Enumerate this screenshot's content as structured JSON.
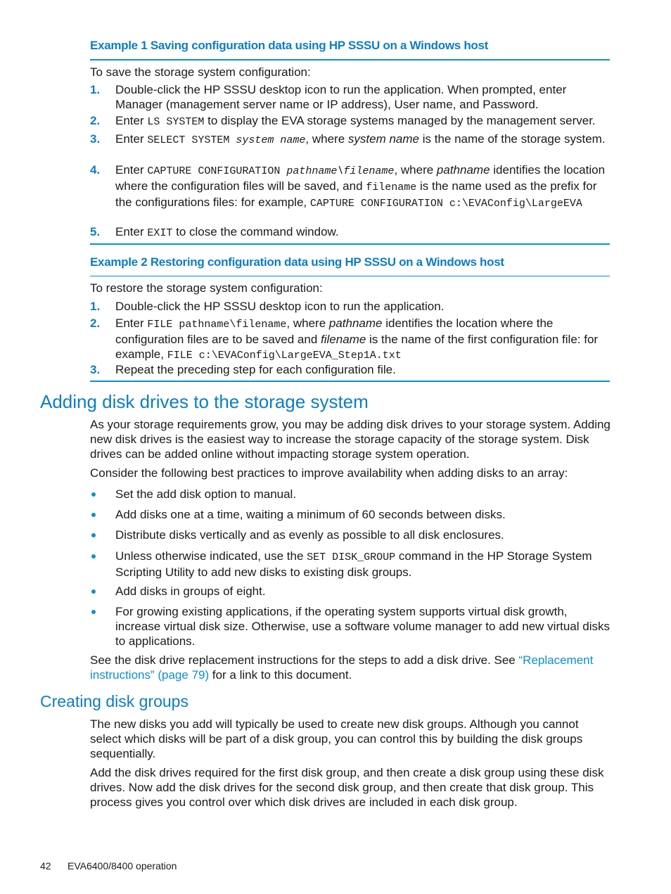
{
  "example1": {
    "title": "Example 1 Saving configuration data using HP SSSU on a Windows host",
    "intro": "To save the storage system configuration:",
    "steps": [
      {
        "num": "1.",
        "text": "Double-click the HP SSSU desktop icon to run the application. When prompted, enter Manager (management server name or IP address), User name, and Password."
      },
      {
        "num": "2.",
        "pre": "Enter ",
        "code": "LS SYSTEM",
        "post": " to display the EVA storage systems managed by the management server."
      },
      {
        "num": "3.",
        "pre": "Enter ",
        "code": "SELECT SYSTEM ",
        "code_ital": "system name",
        "mid": ", where ",
        "ital": "system name",
        "post": " is the name of the storage system."
      },
      {
        "num": "4.",
        "pre": "Enter ",
        "code": "CAPTURE CONFIGURATION ",
        "code_ital": "pathname\\filename",
        "mid": ", where ",
        "ital": "pathname",
        "post": " identifies the location where the configuration files will be saved, and ",
        "code2": "filename",
        "post2": " is the name used as the prefix for the configurations files: for example, ",
        "code3": "CAPTURE CONFIGURATION c:\\EVAConfig\\LargeEVA"
      },
      {
        "num": "5.",
        "pre": "Enter ",
        "code": "EXIT",
        "post": " to close the command window."
      }
    ]
  },
  "example2": {
    "title": "Example 2 Restoring configuration data using HP SSSU on a Windows host",
    "intro": "To restore the storage system configuration:",
    "steps": [
      {
        "num": "1.",
        "text": "Double-click the HP SSSU desktop icon to run the application."
      },
      {
        "num": "2.",
        "pre": "Enter ",
        "code": "FILE pathname\\filename",
        "mid": ", where ",
        "ital": "pathname",
        "post": " identifies the location where the configuration files are to be saved and ",
        "ital2": "filename",
        "post2": " is the name of the first configuration file: for example, ",
        "code2": "FILE c:\\EVAConfig\\LargeEVA_Step1A.txt"
      },
      {
        "num": "3.",
        "text": "Repeat the preceding step for each configuration file."
      }
    ]
  },
  "section_adding": {
    "heading": "Adding disk drives to the storage system",
    "para1": "As your storage requirements grow, you may be adding disk drives to your storage system. Adding new disk drives is the easiest way to increase the storage capacity of the storage system. Disk drives can be added online without impacting storage system operation.",
    "para2": "Consider the following best practices to improve availability when adding disks to an array:",
    "bullets": [
      {
        "text": "Set the add disk option to manual."
      },
      {
        "text": "Add disks one at a time, waiting a minimum of 60 seconds between disks."
      },
      {
        "text": "Distribute disks vertically and as evenly as possible to all disk enclosures."
      },
      {
        "pre": "Unless otherwise indicated, use the ",
        "code": "SET DISK_GROUP",
        "post": " command in the HP Storage System Scripting Utility to add new disks to existing disk groups."
      },
      {
        "text": "Add disks in groups of eight."
      },
      {
        "text": "For growing existing applications, if the operating system supports virtual disk growth, increase virtual disk size. Otherwise, use a software volume manager to add new virtual disks to applications."
      }
    ],
    "para3_pre": "See the disk drive replacement instructions for the steps to add a disk drive. See ",
    "para3_link": "“Replacement instructions” (page 79)",
    "para3_post": " for a link to this document."
  },
  "section_creating": {
    "heading": "Creating disk groups",
    "para1": "The new disks you add will typically be used to create new disk groups. Although you cannot select which disks will be part of a disk group, you can control this by building the disk groups sequentially.",
    "para2": "Add the disk drives required for the first disk group, and then create a disk group using these disk drives. Now add the disk drives for the second disk group, and then create that disk group. This process gives you control over which disk drives are included in each disk group."
  },
  "footer": {
    "page_number": "42",
    "chapter": "EVA6400/8400 operation"
  },
  "colors": {
    "accent": "#0b7ec4",
    "rule": "#0b8fd3",
    "text": "#1a1a1a"
  }
}
